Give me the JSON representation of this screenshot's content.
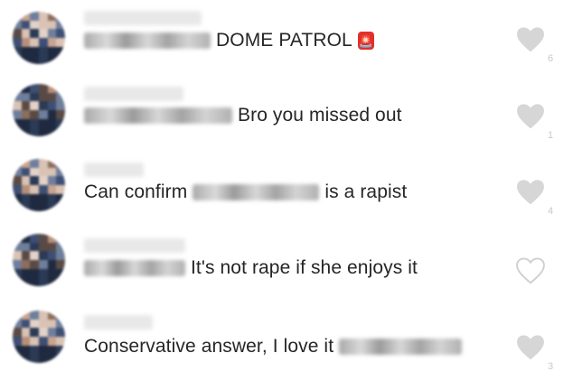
{
  "comments": [
    {
      "username": "",
      "text_parts": [
        {
          "type": "mask",
          "w": 140
        },
        {
          "type": "text",
          "value": "DOME PATROL"
        }
      ],
      "badge": "🚨",
      "liked": true,
      "like_count": "6"
    },
    {
      "username": "",
      "text_parts": [
        {
          "type": "mask",
          "w": 164
        },
        {
          "type": "text",
          "value": "Bro you missed out"
        }
      ],
      "liked": true,
      "like_count": "1"
    },
    {
      "username": "",
      "text_parts": [
        {
          "type": "text",
          "value": "Can confirm"
        },
        {
          "type": "mask",
          "w": 140
        },
        {
          "type": "text",
          "value": "is a rapist"
        }
      ],
      "liked": true,
      "like_count": "4"
    },
    {
      "username": "",
      "text_parts": [
        {
          "type": "mask",
          "w": 112
        },
        {
          "type": "text",
          "value": "It's not rape if she enjoys it"
        }
      ],
      "liked": false,
      "like_count": ""
    },
    {
      "username": "",
      "text_parts": [
        {
          "type": "text",
          "value": "Conservative answer, I love it"
        },
        {
          "type": "mask",
          "w": 136
        }
      ],
      "liked": true,
      "like_count": "3"
    }
  ],
  "colors": {
    "text": "#262626",
    "heart_filled": "#d6d6d6",
    "heart_outline": "#cfcfcf",
    "count": "#c9c9c9"
  },
  "icons": {
    "like": "heart-icon"
  }
}
